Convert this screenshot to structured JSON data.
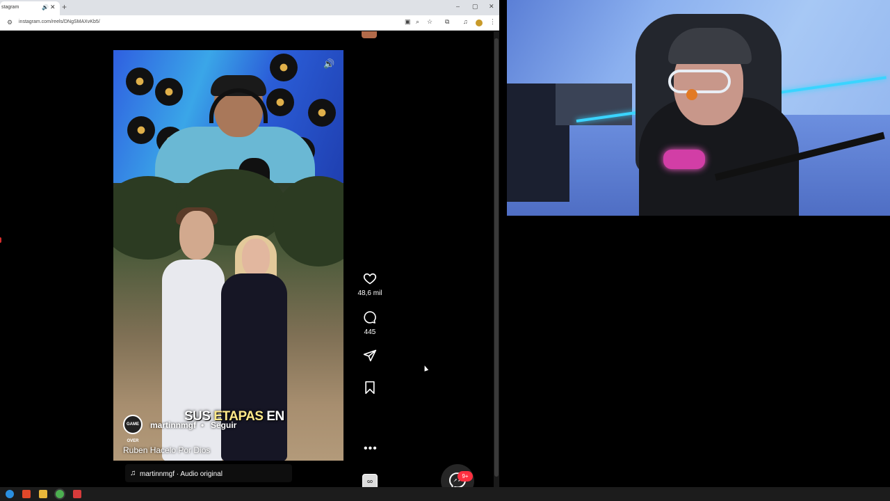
{
  "browser": {
    "tab_title": "stagram",
    "tab_audio_icon": "speaker-icon",
    "tab_close": "✕",
    "new_tab": "+",
    "window_controls": {
      "minimize": "–",
      "maximize": "▢",
      "close": "✕"
    },
    "url": "instagram.com/reels/DNgSMAXvKb5/"
  },
  "reel": {
    "overlay_caption_prefix": "SUS ",
    "overlay_caption_highlight": "ETAPAS",
    "overlay_caption_suffix": " EN",
    "author": "martinnmgf",
    "separator": "•",
    "follow_label": "Seguir",
    "caption": "Ruben Hacelo Por Dios",
    "audio": "martinnmgf · Audio original",
    "avatar_text": "GAME OVER"
  },
  "actions": {
    "likes": "48,6 mil",
    "comments": "445",
    "more": "•••"
  },
  "messages": {
    "badge": "9+"
  },
  "colors": {
    "badge": "#ff3040",
    "accent_led": "#3ad4ff"
  }
}
